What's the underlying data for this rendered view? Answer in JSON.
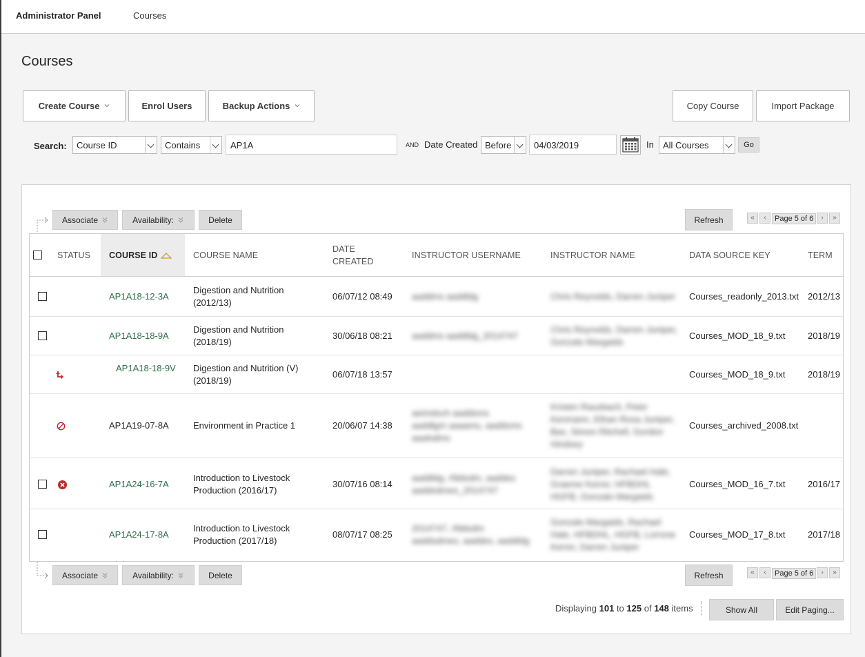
{
  "header": {
    "brand": "Administrator Panel",
    "crumb": "Courses"
  },
  "page": {
    "title": "Courses"
  },
  "actions": {
    "create_course": "Create Course",
    "enrol_users": "Enrol Users",
    "backup_actions": "Backup Actions",
    "copy_course": "Copy Course",
    "import_package": "Import Package"
  },
  "search": {
    "label": "Search:",
    "field": "Course ID",
    "operator": "Contains",
    "value": "AP1A",
    "and_label": "AND",
    "date_label": "Date Created",
    "date_operator": "Before",
    "date_value": "04/03/2019",
    "in_label": "In",
    "scope": "All Courses",
    "go": "Go"
  },
  "toolbar": {
    "associate": "Associate",
    "availability": "Availability:",
    "delete": "Delete",
    "refresh": "Refresh",
    "page_text": "Page 5 of 6"
  },
  "table": {
    "columns": {
      "status": "STATUS",
      "course_id": "COURSE ID",
      "course_name": "COURSE NAME",
      "date_created": "DATE CREATED",
      "instructor_username": "INSTRUCTOR USERNAME",
      "instructor_name": "INSTRUCTOR NAME",
      "data_source_key": "DATA SOURCE KEY",
      "term": "TERM"
    },
    "rows": [
      {
        "id": "AP1A18-12-3A",
        "name1": "Digestion and Nutrition",
        "name2": "(2012/13)",
        "date": "06/07/12 08:49",
        "user1": "aaddms aaddldg",
        "user2": "",
        "user3": "",
        "inst1": "Chris Reynolds, Darren Juniper",
        "inst2": "",
        "inst3": "",
        "inst4": "",
        "dsk": "Courses_readonly_2013.txt",
        "term": "2012/13"
      },
      {
        "id": "AP1A18-18-9A",
        "name1": "Digestion and Nutrition",
        "name2": "(2018/19)",
        "date": "30/06/18 08:21",
        "user1": "aaddms aaddldg_2014747",
        "user2": "",
        "user3": "",
        "inst1": "Chris Reynolds, Darren Juniper,",
        "inst2": "Gonzalo Margaids",
        "inst3": "",
        "inst4": "",
        "dsk": "Courses_MOD_18_9.txt",
        "term": "2018/19"
      },
      {
        "id": "AP1A18-18-9V",
        "name1": "Digestion and Nutrition (V)",
        "name2": "(2018/19)",
        "date": "06/07/18 13:57",
        "user1": "",
        "user2": "",
        "user3": "",
        "inst1": "",
        "inst2": "",
        "inst3": "",
        "inst4": "",
        "dsk": "Courses_MOD_18_9.txt",
        "term": "2018/19"
      },
      {
        "id": "AP1A19-07-8A",
        "name1": "Environment in Practice 1",
        "name2": "",
        "date": "20/06/07 14:38",
        "user1": "aeimdsch aaddsms",
        "user2": "aaddlgm aaaams, aaddsms",
        "user3": "aaalsdms",
        "inst1": "Kristen Rausbach, Peter",
        "inst2": "Kenmann, Ethan Rosa Juniper,",
        "inst3": "Bax, Simon Ritchell, Gordon",
        "inst4": "Hindsey",
        "dsk": "Courses_archived_2008.txt",
        "term": ""
      },
      {
        "id": "AP1A24-16-7A",
        "name1": "Introduction to Livestock",
        "name2": "Production (2016/17)",
        "date": "30/07/16 08:14",
        "user1": "aaddldg, rfddsdm, aaddes",
        "user2": "aaddsdmes_2014747",
        "user3": "",
        "inst1": "Darren Juniper, Rachael Hale,",
        "inst2": "Graeme Kerrer, HFBDHL",
        "inst3": "HGFB, Gonzalo Margaids",
        "inst4": "",
        "dsk": "Courses_MOD_16_7.txt",
        "term": "2016/17"
      },
      {
        "id": "AP1A24-17-8A",
        "name1": "Introduction to Livestock",
        "name2": "Production (2017/18)",
        "date": "08/07/17 08:25",
        "user1": "2014747, rfddsdm",
        "user2": "aaddsdmes, aaddes, aaddldg",
        "user3": "",
        "inst1": "Gonzalo Margaids, Rachael",
        "inst2": "Hale, HFBDHL, HGFB, Lorrone",
        "inst3": "Kerrer, Darren Juniper",
        "inst4": "",
        "dsk": "Courses_MOD_17_8.txt",
        "term": "2017/18"
      }
    ]
  },
  "footer": {
    "displaying": "Displaying",
    "from": "101",
    "to_word": "to",
    "to": "125",
    "of_word": "of",
    "total": "148",
    "items_word": "items",
    "show_all": "Show All",
    "edit_paging": "Edit Paging..."
  },
  "colors": {
    "link": "#2e6e4c",
    "error": "#c0272d"
  }
}
